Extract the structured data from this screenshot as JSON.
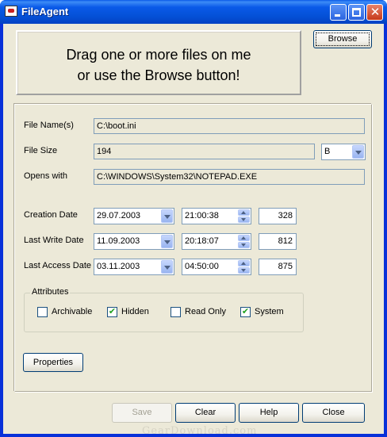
{
  "window": {
    "title": "FileAgent"
  },
  "drop": {
    "line1": "Drag one or more files on me",
    "line2": "or use the Browse button!"
  },
  "browse_label": "Browse",
  "fields": {
    "file_name": {
      "label": "File Name(s)",
      "value": "C:\\boot.ini"
    },
    "file_size": {
      "label": "File Size",
      "value": "194",
      "unit": "B"
    },
    "opens_with": {
      "label": "Opens with",
      "value": "C:\\WINDOWS\\System32\\NOTEPAD.EXE"
    }
  },
  "dates": {
    "creation": {
      "label": "Creation Date",
      "date": "29.07.2003",
      "time": "21:00:38",
      "ms": "328"
    },
    "last_write": {
      "label": "Last Write Date",
      "date": "11.09.2003",
      "time": "20:18:07",
      "ms": "812"
    },
    "last_access": {
      "label": "Last Access Date",
      "date": "03.11.2003",
      "time": "04:50:00",
      "ms": "875"
    }
  },
  "attributes": {
    "title": "Attributes",
    "archivable": {
      "label": "Archivable",
      "checked": false
    },
    "hidden": {
      "label": "Hidden",
      "checked": true
    },
    "read_only": {
      "label": "Read Only",
      "checked": false
    },
    "system": {
      "label": "System",
      "checked": true
    }
  },
  "properties_label": "Properties",
  "buttons": {
    "save": "Save",
    "clear": "Clear",
    "help": "Help",
    "close": "Close"
  },
  "watermark": "GearDownload.com"
}
